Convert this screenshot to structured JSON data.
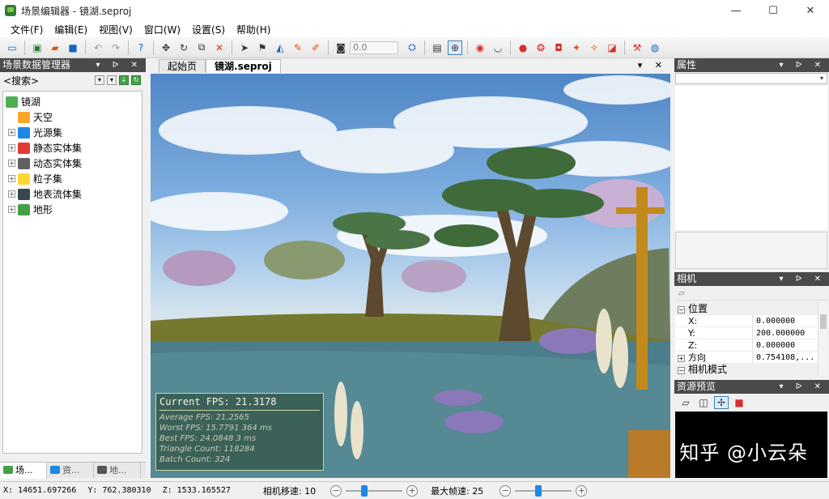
{
  "window": {
    "title": "场景编辑器 - 镜湖.seproj",
    "controls": {
      "minimize": "—",
      "maximize": "☐",
      "close": "✕"
    }
  },
  "menu": [
    "文件(F)",
    "编辑(E)",
    "视图(V)",
    "窗口(W)",
    "设置(S)",
    "帮助(H)"
  ],
  "toolbar": {
    "field_value": "0.0",
    "icons": [
      "new-icon",
      "open-icon",
      "folder-icon",
      "save-icon",
      "undo-icon",
      "redo-icon",
      "help-icon",
      "move-icon",
      "rotate-icon",
      "scale-icon",
      "delete-icon",
      "select-icon",
      "flag-icon",
      "terrain-icon",
      "paint-icon",
      "brush-icon",
      "camera-icon",
      "snap-icon",
      "grid-icon",
      "eye-icon",
      "eye-closed-icon",
      "render-icons"
    ]
  },
  "left_panel": {
    "title": "场景数据管理器",
    "search_placeholder": "<搜索>",
    "tree": [
      {
        "label": "镜湖",
        "icon": "scene-icon",
        "color": "#4caf50"
      },
      {
        "label": "天空",
        "icon": "sky-icon",
        "color": "#f9a825"
      },
      {
        "label": "光源集",
        "icon": "light-icon",
        "color": "#1e88e5"
      },
      {
        "label": "静态实体集",
        "icon": "static-entity-icon",
        "color": "#e53935"
      },
      {
        "label": "动态实体集",
        "icon": "dynamic-entity-icon",
        "color": "#616161"
      },
      {
        "label": "粒子集",
        "icon": "particle-icon",
        "color": "#fdd835"
      },
      {
        "label": "地表流体集",
        "icon": "fluid-icon",
        "color": "#37474f"
      },
      {
        "label": "地形",
        "icon": "terrain-icon",
        "color": "#43a047"
      }
    ],
    "tabs": [
      "场...",
      "资...",
      "地..."
    ]
  },
  "doc_tabs": [
    "起始页",
    "镜湖.seproj"
  ],
  "fps": {
    "current": "Current FPS: 21.3178",
    "average": "Average FPS: 21.2565",
    "worst": "Worst FPS: 15.7791 364 ms",
    "best": "Best FPS: 24.0848 3 ms",
    "triangles": "Triangle Count: 118284",
    "batches": "Batch Count: 324"
  },
  "right_panel": {
    "properties_title": "属性",
    "camera_title": "相机",
    "camera_rows": [
      {
        "type": "category",
        "label": "位置",
        "sign": "⊟"
      },
      {
        "type": "value",
        "label": "X:",
        "value": "0.000000"
      },
      {
        "type": "value",
        "label": "Y:",
        "value": "200.000000"
      },
      {
        "type": "value",
        "label": "Z:",
        "value": "0.000000"
      },
      {
        "type": "value",
        "label": "方向",
        "value": "0.754108,...",
        "sign": "⊞"
      },
      {
        "type": "category",
        "label": "相机模式",
        "sign": "⊟"
      }
    ],
    "resource_title": "资源预览",
    "watermark": "知乎 @小云朵"
  },
  "status": {
    "x": "X: 14651.697266",
    "y": "Y: 762.380310",
    "z": "Z: 1533.165527",
    "camera_speed_label": "相机移速: 10",
    "camera_speed": 0.3,
    "max_fps_label": "最大帧速: 25",
    "max_fps": 0.4
  }
}
